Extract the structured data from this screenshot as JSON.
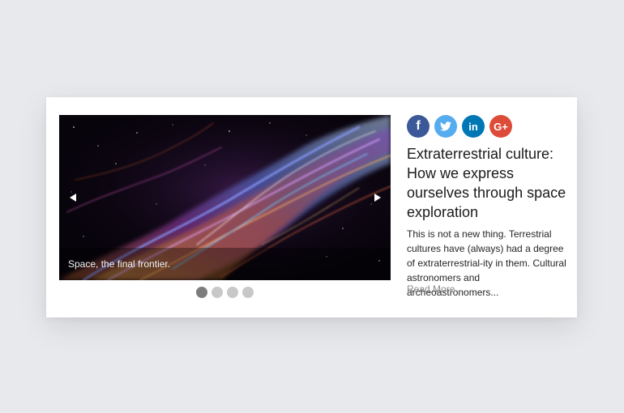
{
  "carousel": {
    "caption": "Space, the final frontier.",
    "slides": [
      {
        "name": "slide-1",
        "active": true
      },
      {
        "name": "slide-2",
        "active": false
      },
      {
        "name": "slide-3",
        "active": false
      },
      {
        "name": "slide-4",
        "active": false
      }
    ],
    "prev_icon": "triangle-left-icon",
    "next_icon": "triangle-right-icon"
  },
  "social": {
    "items": [
      {
        "network": "facebook",
        "glyph": "f",
        "color": "#3b5998"
      },
      {
        "network": "twitter",
        "glyph": "twitter-bird",
        "color": "#55acee"
      },
      {
        "network": "linkedin",
        "glyph": "in",
        "color": "#0077b5"
      },
      {
        "network": "google-plus",
        "glyph": "G+",
        "color": "#dd4b39"
      }
    ]
  },
  "article": {
    "title": "Extraterrestrial culture: How we express ourselves through space exploration",
    "excerpt": "This is not a new thing. Terrestrial cultures have (always) had a degree of extraterrestrial-ity in them. Cultural astronomers and archeoastronomers...",
    "read_more": "Read More"
  },
  "colors": {
    "background": "#e8e9ec",
    "card": "#ffffff",
    "dot_active": "#7d7d7d",
    "dot_inactive": "#c8c8c8",
    "read_more": "#8a8a8a"
  }
}
